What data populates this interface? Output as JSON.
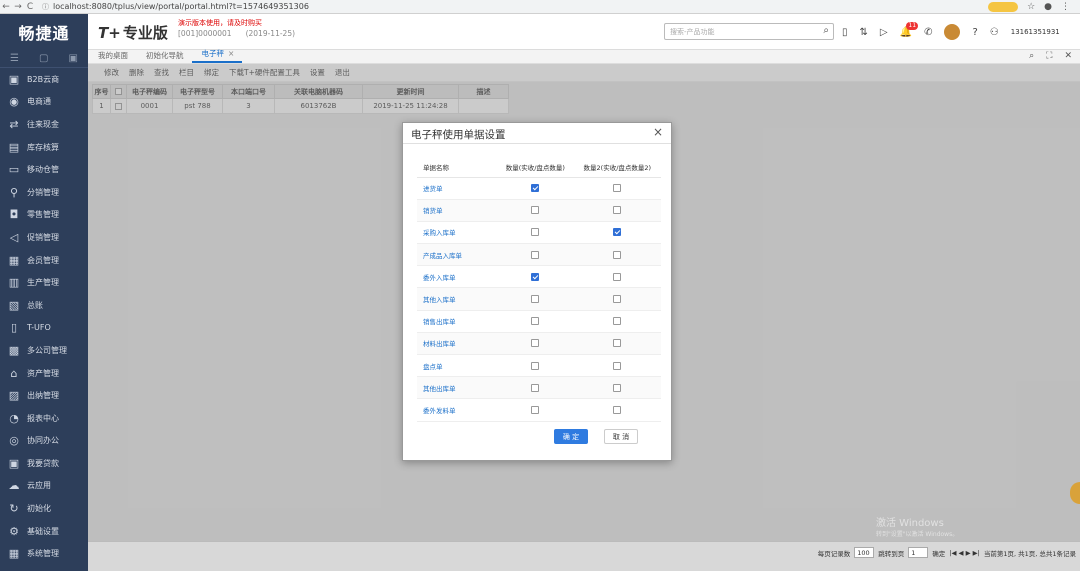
{
  "browser": {
    "url": "localhost:8080/tplus/view/portal/portal.html?t=1574649351306",
    "back": "←",
    "forward": "→",
    "reload": "C"
  },
  "header": {
    "logo": "畅捷通",
    "product": "T+",
    "product_sub": "专业版",
    "demo_note": "演示版本使用，请及时购买",
    "account_no": "[001]0000001",
    "account_date": "(2019-11-25)",
    "search_placeholder": "搜索-产品功能",
    "notify_count": "11",
    "user": "13161351931"
  },
  "sidebar": {
    "items": [
      {
        "icon": "▣",
        "label": "B2B云商"
      },
      {
        "icon": "◉",
        "label": "电商通"
      },
      {
        "icon": "⇄",
        "label": "往来现金"
      },
      {
        "icon": "▤",
        "label": "库存核算"
      },
      {
        "icon": "▭",
        "label": "移动仓管"
      },
      {
        "icon": "⚲",
        "label": "分销管理"
      },
      {
        "icon": "◘",
        "label": "零售管理"
      },
      {
        "icon": "◁",
        "label": "促销管理"
      },
      {
        "icon": "▦",
        "label": "会员管理"
      },
      {
        "icon": "▥",
        "label": "生产管理"
      },
      {
        "icon": "▧",
        "label": "总账"
      },
      {
        "icon": "▯",
        "label": "T-UFO"
      },
      {
        "icon": "▩",
        "label": "多公司管理"
      },
      {
        "icon": "⌂",
        "label": "资产管理"
      },
      {
        "icon": "▨",
        "label": "出纳管理"
      },
      {
        "icon": "◔",
        "label": "报表中心"
      },
      {
        "icon": "◎",
        "label": "协同办公"
      },
      {
        "icon": "▣",
        "label": "我要贷款"
      },
      {
        "icon": "☁",
        "label": "云应用"
      },
      {
        "icon": "↻",
        "label": "初始化"
      },
      {
        "icon": "⚙",
        "label": "基础设置"
      },
      {
        "icon": "▦",
        "label": "系统管理"
      }
    ]
  },
  "tabs": [
    {
      "label": "我的桌面"
    },
    {
      "label": "初始化导航"
    },
    {
      "label": "电子秤",
      "close": "×"
    }
  ],
  "toolbar": [
    "修改",
    "删除",
    "查找",
    "栏目",
    "绑定",
    "下载T+硬件配置工具",
    "设置",
    "退出"
  ],
  "grid": {
    "headers": [
      "序号",
      "",
      "电子秤编码",
      "电子秤型号",
      "本口端口号",
      "关联电脑机器码",
      "更新时间",
      "描述"
    ],
    "rows": [
      [
        "1",
        "",
        "0001",
        "pst 788",
        "3",
        "6013762B",
        "2019-11-25 11:24:28",
        ""
      ]
    ]
  },
  "pager": {
    "per_page_label": "每页记录数",
    "per_page": "100",
    "goto_label": "跳转到页",
    "goto_page": "1",
    "go": "确定",
    "nav": "|◀ ◀ ▶ ▶|",
    "summary": "当前第1页, 共1页, 总共1条记录"
  },
  "watermark": {
    "line1": "激活 Windows",
    "line2": "转到\"设置\"以激活 Windows。"
  },
  "dialog": {
    "title": "电子秤使用单据设置",
    "close": "×",
    "headers": [
      "单据名称",
      "数量(实收/盘点数量)",
      "数量2(实收/盘点数量2)"
    ],
    "rows": [
      {
        "name": "进货单",
        "qty": true,
        "qty2": false
      },
      {
        "name": "销货单",
        "qty": false,
        "qty2": false
      },
      {
        "name": "采购入库单",
        "qty": false,
        "qty2": true
      },
      {
        "name": "产成品入库单",
        "qty": false,
        "qty2": false
      },
      {
        "name": "委外入库单",
        "qty": true,
        "qty2": false
      },
      {
        "name": "其他入库单",
        "qty": false,
        "qty2": false
      },
      {
        "name": "销售出库单",
        "qty": false,
        "qty2": false
      },
      {
        "name": "材料出库单",
        "qty": false,
        "qty2": false
      },
      {
        "name": "盘点单",
        "qty": false,
        "qty2": false
      },
      {
        "name": "其他出库单",
        "qty": false,
        "qty2": false
      },
      {
        "name": "委外发料单",
        "qty": false,
        "qty2": false
      }
    ],
    "ok": "确 定",
    "cancel": "取 消"
  }
}
